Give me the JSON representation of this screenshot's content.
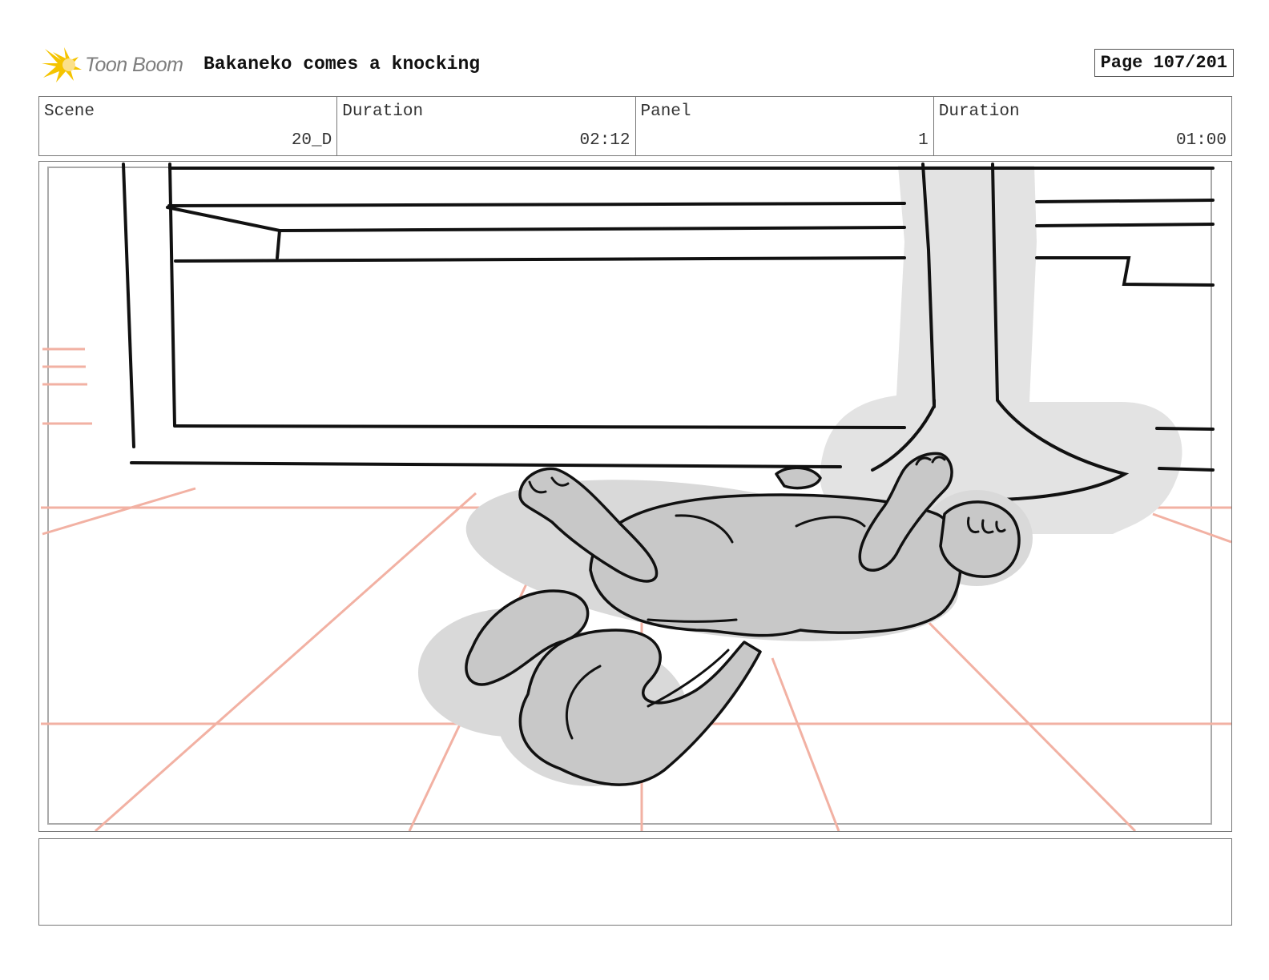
{
  "header": {
    "logo_text": "Toon Boom",
    "title": "Bakaneko comes a knocking",
    "page": "Page 107/201"
  },
  "info": {
    "scene_label": "Scene",
    "scene_value": "20_D",
    "scene_duration_label": "Duration",
    "scene_duration_value": "02:12",
    "panel_label": "Panel",
    "panel_value": "1",
    "panel_duration_label": "Duration",
    "panel_duration_value": "01:00"
  },
  "panel": {
    "image": "storyboard-drawing-cat-lying-on-floor",
    "colors": {
      "guide_lines": "#f2b1a3",
      "fill_gray": "#c8c8c8",
      "shadow_gray": "#e3e3e3",
      "ink": "#111111"
    }
  },
  "notes": {
    "text": ""
  }
}
